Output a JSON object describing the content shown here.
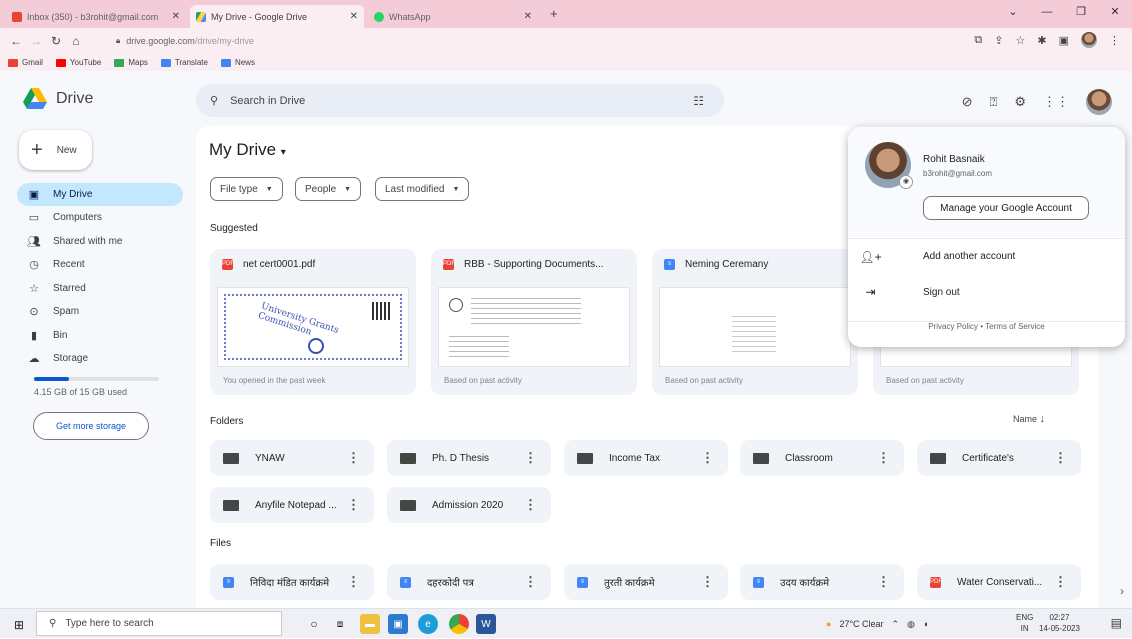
{
  "browser": {
    "tabs": [
      {
        "label": "Inbox (350) - b3rohit@gmail.com",
        "color": "#ea4335"
      },
      {
        "label": "My Drive - Google Drive",
        "color": "#1fa463"
      },
      {
        "label": "WhatsApp",
        "color": "#25d366"
      }
    ],
    "new_tab": "+",
    "url_domain": "drive.google.com",
    "url_path": "/drive/my-drive",
    "bookmarks": [
      {
        "label": "Gmail",
        "color": "#ea4335"
      },
      {
        "label": "YouTube",
        "color": "#ff0000"
      },
      {
        "label": "Maps",
        "color": "#34a853"
      },
      {
        "label": "Translate",
        "color": "#4285f4"
      },
      {
        "label": "News",
        "color": "#4285f4"
      }
    ]
  },
  "drive": {
    "app_name": "Drive",
    "search_placeholder": "Search in Drive",
    "new_label": "New",
    "nav": [
      {
        "label": "My Drive",
        "icon": "my-drive-icon",
        "active": true
      },
      {
        "label": "Computers",
        "icon": "computer-icon",
        "active": false
      },
      {
        "label": "Shared with me",
        "icon": "shared-icon",
        "active": false
      },
      {
        "label": "Recent",
        "icon": "clock-icon",
        "active": false
      },
      {
        "label": "Starred",
        "icon": "star-icon",
        "active": false
      },
      {
        "label": "Spam",
        "icon": "spam-icon",
        "active": false
      },
      {
        "label": "Bin",
        "icon": "bin-icon",
        "active": false
      },
      {
        "label": "Storage",
        "icon": "cloud-icon",
        "active": false
      }
    ],
    "storage_text": "4.15 GB of 15 GB used",
    "storage_fraction": 0.277,
    "get_storage": "Get more storage",
    "title": "My Drive",
    "filters": [
      "File type",
      "People",
      "Last modified"
    ],
    "suggested_label": "Suggested",
    "suggested": [
      {
        "name": "net cert0001.pdf",
        "type": "pdf",
        "reason": "You opened in the past week"
      },
      {
        "name": "RBB - Supporting Documents...",
        "type": "pdf",
        "reason": "Based on past activity"
      },
      {
        "name": "Neming Ceremany",
        "type": "doc",
        "reason": "Based on past activity"
      },
      {
        "name": "",
        "type": "doc",
        "reason": "Based on past activity"
      }
    ],
    "folders_label": "Folders",
    "sort_label": "Name",
    "folders": [
      "YNAW",
      "Ph. D Thesis",
      "Income Tax",
      "Classroom",
      "Certificate's",
      "Anyfile Notepad ...",
      "Admission 2020"
    ],
    "files_label": "Files",
    "files": [
      {
        "name": "निविदा मंडित कार्यक्रमे",
        "type": "doc"
      },
      {
        "name": "दहरकोदी पत्र",
        "type": "doc"
      },
      {
        "name": "तुरती कार्यक्रमे",
        "type": "doc"
      },
      {
        "name": "उदय कार्यक्रमे",
        "type": "doc"
      },
      {
        "name": "Water Conservati...",
        "type": "pdf"
      }
    ]
  },
  "account": {
    "name": "Rohit Basnaik",
    "email": "b3rohit@gmail.com",
    "manage": "Manage your Google Account",
    "add_account": "Add another account",
    "sign_out": "Sign out",
    "privacy": "Privacy Policy",
    "separator": "•",
    "terms": "Terms of Service"
  },
  "taskbar": {
    "search_placeholder": "Type here to search",
    "weather": "27°C Clear",
    "lang_top": "ENG",
    "lang_bottom": "IN",
    "time": "02:27",
    "date": "14-05-2023"
  }
}
